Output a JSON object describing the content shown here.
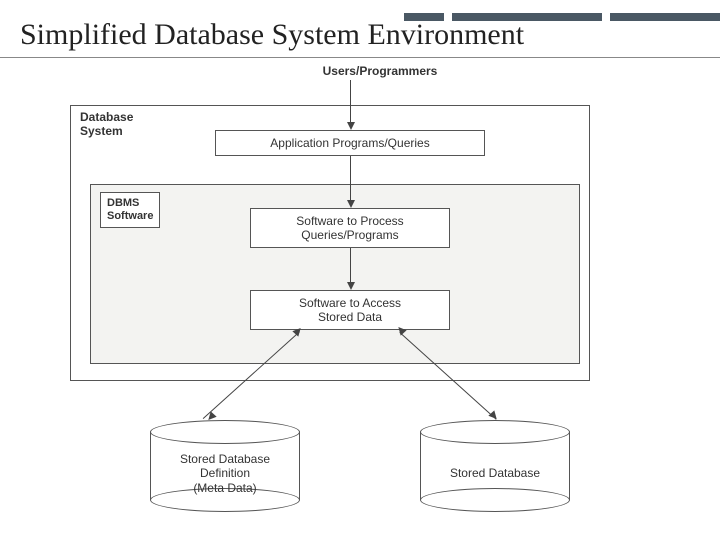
{
  "title": "Simplified Database System Environment",
  "diagram": {
    "users": "Users/Programmers",
    "dbsystem": "Database\nSystem",
    "appbox": "Application Programs/Queries",
    "dbms": "DBMS\nSoftware",
    "processbox": "Software to Process\nQueries/Programs",
    "accessbox": "Software to Access\nStored Data",
    "cyl_left": "Stored Database\nDefinition\n(Meta Data)",
    "cyl_right": "Stored Database"
  }
}
